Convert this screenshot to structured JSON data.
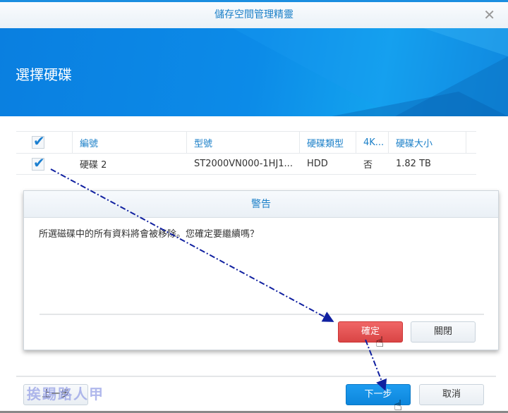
{
  "window": {
    "title": "儲存空間管理精靈",
    "close_icon": "close-icon"
  },
  "banner": {
    "title": "選擇硬碟"
  },
  "table": {
    "headers": [
      "編號",
      "型號",
      "硬碟類型",
      "4K...",
      "硬碟大小"
    ],
    "rows": [
      {
        "checked": true,
        "id": "硬碟 2",
        "model": "ST2000VN000-1HJ1...",
        "type": "HDD",
        "4k": "否",
        "size": "1.82 TB"
      }
    ]
  },
  "dialog": {
    "title": "警告",
    "message": "所選磁碟中的所有資料將會被移除。您確定要繼續嗎？",
    "confirm": "確定",
    "close": "關閉"
  },
  "footer": {
    "back": "上一步",
    "next": "下一步",
    "cancel": "取消"
  },
  "watermark": "挨踢路人甲",
  "colors": {
    "accent": "#1a7fc8",
    "danger": "#d94545",
    "primary": "#0c86dc"
  }
}
